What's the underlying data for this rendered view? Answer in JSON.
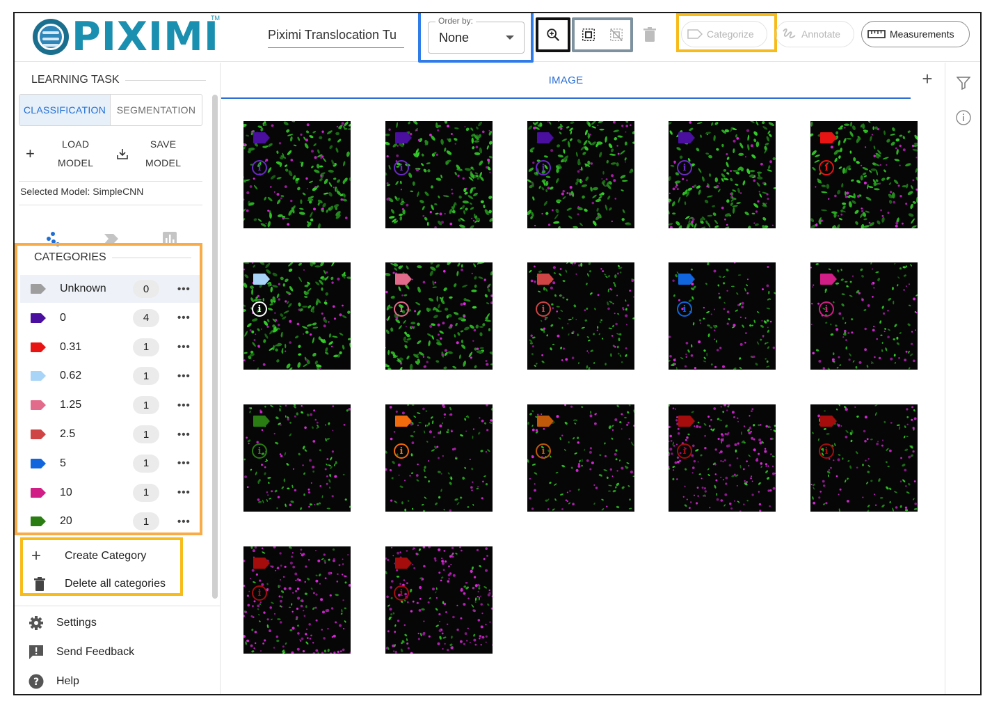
{
  "header": {
    "logo_text": "PIXIMI",
    "logo_tm": "TM",
    "project_name": "Piximi Translocation Tu",
    "order_by": {
      "label": "Order by:",
      "value": "None"
    },
    "buttons": {
      "categorize": "Categorize",
      "annotate": "Annotate",
      "measurements": "Measurements"
    }
  },
  "sidebar": {
    "learning_task_title": "LEARNING TASK",
    "tabs": [
      {
        "label": "CLASSIFICATION",
        "active": true
      },
      {
        "label": "SEGMENTATION",
        "active": false
      }
    ],
    "load_model": {
      "line1": "LOAD",
      "line2": "MODEL"
    },
    "save_model": {
      "line1": "SAVE",
      "line2": "MODEL"
    },
    "selected_model": "Selected Model: SimpleCNN",
    "categories_title": "CATEGORIES",
    "categories": [
      {
        "name": "Unknown",
        "count": "0",
        "color": "#9e9e9e"
      },
      {
        "name": "0",
        "count": "4",
        "color": "#4a0f9e"
      },
      {
        "name": "0.31",
        "count": "1",
        "color": "#e81414"
      },
      {
        "name": "0.62",
        "count": "1",
        "color": "#a8d4f7"
      },
      {
        "name": "1.25",
        "count": "1",
        "color": "#e26a8a"
      },
      {
        "name": "2.5",
        "count": "1",
        "color": "#cf4545"
      },
      {
        "name": "5",
        "count": "1",
        "color": "#1166dd"
      },
      {
        "name": "10",
        "count": "1",
        "color": "#d11e86"
      },
      {
        "name": "20",
        "count": "1",
        "color": "#2a7d12"
      }
    ],
    "create_category": "Create Category",
    "delete_all_categories": "Delete all categories",
    "footer": {
      "settings": "Settings",
      "send_feedback": "Send Feedback",
      "help": "Help"
    }
  },
  "main": {
    "tab_label": "IMAGE",
    "images": [
      {
        "tag_color": "#4a0f9e",
        "info_color": "#6a2ac4",
        "density": "high"
      },
      {
        "tag_color": "#4a0f9e",
        "info_color": "#6a2ac4",
        "density": "high"
      },
      {
        "tag_color": "#4a0f9e",
        "info_color": "#6a2ac4",
        "density": "high"
      },
      {
        "tag_color": "#4a0f9e",
        "info_color": "#6a2ac4",
        "density": "high"
      },
      {
        "tag_color": "#e81414",
        "info_color": "#e81414",
        "density": "high"
      },
      {
        "tag_color": "#a8d4f7",
        "info_color": "#ffffff",
        "density": "high"
      },
      {
        "tag_color": "#e26a8a",
        "info_color": "#e26a8a",
        "density": "high"
      },
      {
        "tag_color": "#cf4545",
        "info_color": "#cf4545",
        "density": "medium"
      },
      {
        "tag_color": "#1166dd",
        "info_color": "#1166dd",
        "density": "low"
      },
      {
        "tag_color": "#d11e86",
        "info_color": "#d11e86",
        "density": "low"
      },
      {
        "tag_color": "#2a7d12",
        "info_color": "#2a7d12",
        "density": "low"
      },
      {
        "tag_color": "#f26b0c",
        "info_color": "#f26b0c",
        "density": "low"
      },
      {
        "tag_color": "#c0590a",
        "info_color": "#c0590a",
        "density": "low"
      },
      {
        "tag_color": "#a50d0d",
        "info_color": "#a50d0d",
        "density": "magenta"
      },
      {
        "tag_color": "#a50d0d",
        "info_color": "#a50d0d",
        "density": "low"
      },
      {
        "tag_color": "#a50d0d",
        "info_color": "#a50d0d",
        "density": "magenta"
      },
      {
        "tag_color": "#a50d0d",
        "info_color": "#a50d0d",
        "density": "magenta"
      }
    ]
  },
  "colors": {
    "accent_blue": "#2b6fd4",
    "highlight_orange": "#f8ab47",
    "highlight_yellow": "#f7bb1b",
    "highlight_blue": "#2f7be8",
    "logo": "#1a8fb0"
  }
}
